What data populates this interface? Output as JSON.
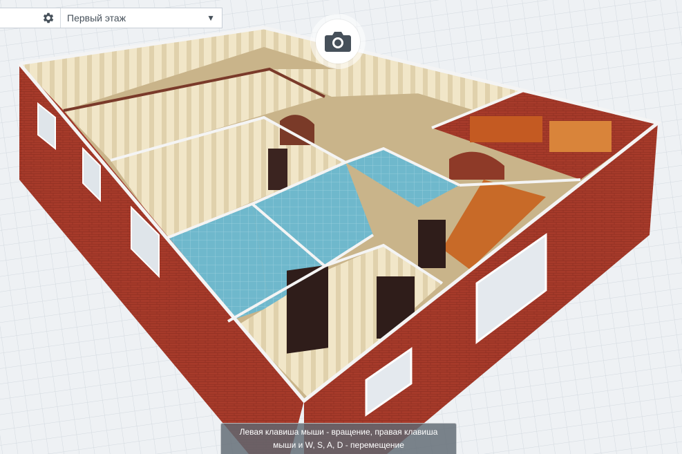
{
  "toolbar": {
    "settings_icon": "gear-icon",
    "floor_select": {
      "selected": "Первый этаж",
      "chevron": "▼"
    }
  },
  "camera_button": {
    "icon": "camera-icon"
  },
  "hint": {
    "line1": "Левая клавиша мыши - вращение, правая клавиша",
    "line2": "мыши и W, S, A, D - перемещение"
  },
  "colors": {
    "brick": "#a63a2a",
    "tile": "#6fb8cc",
    "wallpaper": "#f1e6c8",
    "floor_grid": "#eef1f4",
    "icon": "#46505a"
  }
}
